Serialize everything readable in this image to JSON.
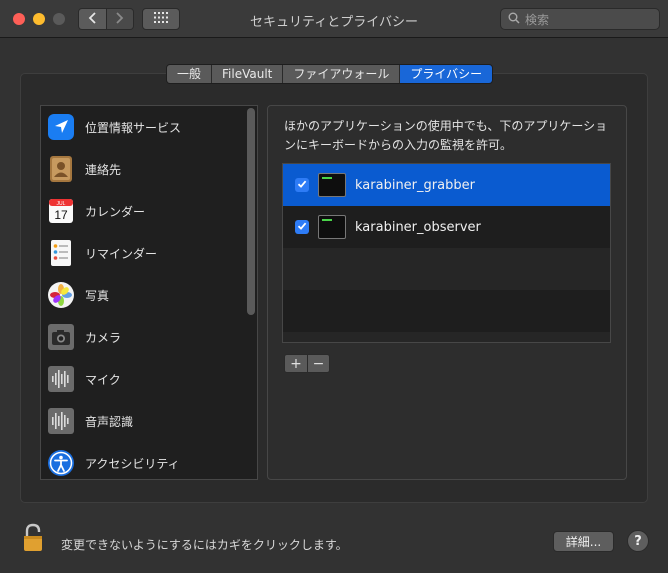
{
  "window": {
    "title": "セキュリティとプライバシー",
    "search_placeholder": "検索"
  },
  "tabs": [
    {
      "label": "一般",
      "active": false
    },
    {
      "label": "FileVault",
      "active": false
    },
    {
      "label": "ファイアウォール",
      "active": false
    },
    {
      "label": "プライバシー",
      "active": true
    }
  ],
  "sidebar": {
    "items": [
      {
        "label": "位置情報サービス",
        "icon": "location-arrow-icon"
      },
      {
        "label": "連絡先",
        "icon": "contacts-icon"
      },
      {
        "label": "カレンダー",
        "icon": "calendar-icon"
      },
      {
        "label": "リマインダー",
        "icon": "reminders-icon"
      },
      {
        "label": "写真",
        "icon": "photos-icon"
      },
      {
        "label": "カメラ",
        "icon": "camera-icon"
      },
      {
        "label": "マイク",
        "icon": "microphone-icon"
      },
      {
        "label": "音声認識",
        "icon": "speech-recognition-icon"
      },
      {
        "label": "アクセシビリティ",
        "icon": "accessibility-icon"
      }
    ],
    "calendar": {
      "month": "JUL",
      "day": "17"
    }
  },
  "main": {
    "description": "ほかのアプリケーションの使用中でも、下のアプリケーションにキーボードからの入力の監視を許可。",
    "apps": [
      {
        "name": "karabiner_grabber",
        "checked": true,
        "selected": true
      },
      {
        "name": "karabiner_observer",
        "checked": true,
        "selected": false
      }
    ],
    "add_label": "+",
    "remove_label": "−"
  },
  "footer": {
    "lock_text": "変更できないようにするにはカギをクリックします。",
    "details_label": "詳細...",
    "help_label": "?"
  },
  "colors": {
    "accent": "#1967d8",
    "selection": "#0a5bd0",
    "close": "#fe5f57",
    "minimize": "#febc2e"
  }
}
